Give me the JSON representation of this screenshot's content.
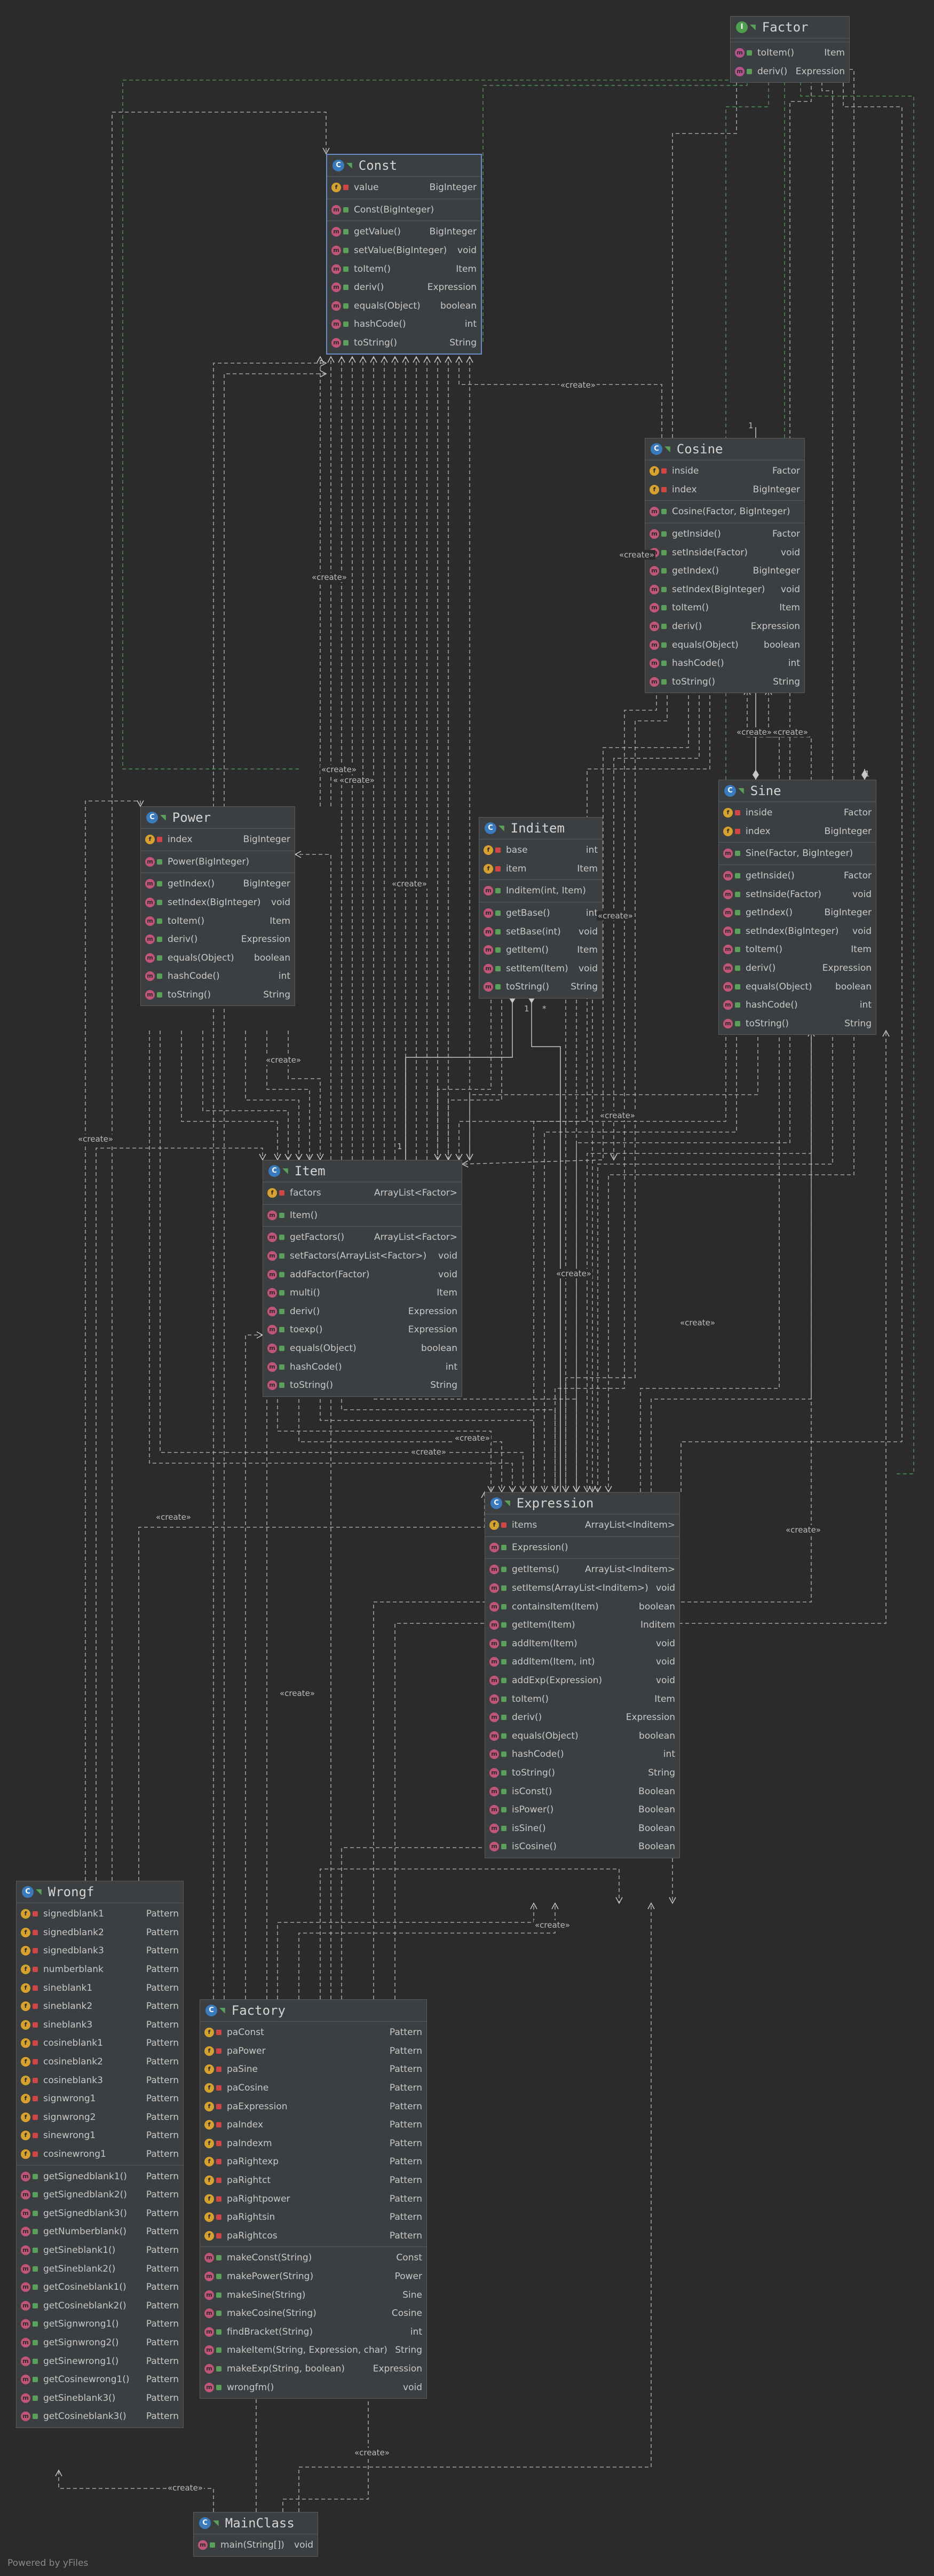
{
  "classes": {
    "factor": {
      "name": "Factor",
      "kind": "I",
      "fields": [],
      "methods": [
        {
          "name": "toItem()",
          "type": "Item"
        },
        {
          "name": "deriv()",
          "type": "Expression"
        }
      ]
    },
    "const": {
      "name": "Const",
      "kind": "C",
      "fields": [
        {
          "name": "value",
          "type": "BigInteger"
        }
      ],
      "constructors": [
        {
          "name": "Const(BigInteger)",
          "type": ""
        }
      ],
      "methods": [
        {
          "name": "getValue()",
          "type": "BigInteger"
        },
        {
          "name": "setValue(BigInteger)",
          "type": "void"
        },
        {
          "name": "toItem()",
          "type": "Item"
        },
        {
          "name": "deriv()",
          "type": "Expression"
        },
        {
          "name": "equals(Object)",
          "type": "boolean"
        },
        {
          "name": "hashCode()",
          "type": "int"
        },
        {
          "name": "toString()",
          "type": "String"
        }
      ]
    },
    "cosine": {
      "name": "Cosine",
      "kind": "C",
      "fields": [
        {
          "name": "inside",
          "type": "Factor"
        },
        {
          "name": "index",
          "type": "BigInteger"
        }
      ],
      "constructors": [
        {
          "name": "Cosine(Factor, BigInteger)",
          "type": ""
        }
      ],
      "methods": [
        {
          "name": "getInside()",
          "type": "Factor"
        },
        {
          "name": "setInside(Factor)",
          "type": "void"
        },
        {
          "name": "getIndex()",
          "type": "BigInteger"
        },
        {
          "name": "setIndex(BigInteger)",
          "type": "void"
        },
        {
          "name": "toItem()",
          "type": "Item"
        },
        {
          "name": "deriv()",
          "type": "Expression"
        },
        {
          "name": "equals(Object)",
          "type": "boolean"
        },
        {
          "name": "hashCode()",
          "type": "int"
        },
        {
          "name": "toString()",
          "type": "String"
        }
      ]
    },
    "sine": {
      "name": "Sine",
      "kind": "C",
      "fields": [
        {
          "name": "inside",
          "type": "Factor"
        },
        {
          "name": "index",
          "type": "BigInteger"
        }
      ],
      "constructors": [
        {
          "name": "Sine(Factor, BigInteger)",
          "type": ""
        }
      ],
      "methods": [
        {
          "name": "getInside()",
          "type": "Factor"
        },
        {
          "name": "setInside(Factor)",
          "type": "void"
        },
        {
          "name": "getIndex()",
          "type": "BigInteger"
        },
        {
          "name": "setIndex(BigInteger)",
          "type": "void"
        },
        {
          "name": "toItem()",
          "type": "Item"
        },
        {
          "name": "deriv()",
          "type": "Expression"
        },
        {
          "name": "equals(Object)",
          "type": "boolean"
        },
        {
          "name": "hashCode()",
          "type": "int"
        },
        {
          "name": "toString()",
          "type": "String"
        }
      ]
    },
    "power": {
      "name": "Power",
      "kind": "C",
      "fields": [
        {
          "name": "index",
          "type": "BigInteger"
        }
      ],
      "constructors": [
        {
          "name": "Power(BigInteger)",
          "type": ""
        }
      ],
      "methods": [
        {
          "name": "getIndex()",
          "type": "BigInteger"
        },
        {
          "name": "setIndex(BigInteger)",
          "type": "void"
        },
        {
          "name": "toItem()",
          "type": "Item"
        },
        {
          "name": "deriv()",
          "type": "Expression"
        },
        {
          "name": "equals(Object)",
          "type": "boolean"
        },
        {
          "name": "hashCode()",
          "type": "int"
        },
        {
          "name": "toString()",
          "type": "String"
        }
      ]
    },
    "inditem": {
      "name": "Inditem",
      "kind": "C",
      "fields": [
        {
          "name": "base",
          "type": "int"
        },
        {
          "name": "item",
          "type": "Item"
        }
      ],
      "constructors": [
        {
          "name": "Inditem(int, Item)",
          "type": ""
        }
      ],
      "methods": [
        {
          "name": "getBase()",
          "type": "int"
        },
        {
          "name": "setBase(int)",
          "type": "void"
        },
        {
          "name": "getItem()",
          "type": "Item"
        },
        {
          "name": "setItem(Item)",
          "type": "void"
        },
        {
          "name": "toString()",
          "type": "String"
        }
      ]
    },
    "item": {
      "name": "Item",
      "kind": "C",
      "fields": [
        {
          "name": "factors",
          "type": "ArrayList<Factor>"
        }
      ],
      "constructors": [
        {
          "name": "Item()",
          "type": ""
        }
      ],
      "methods": [
        {
          "name": "getFactors()",
          "type": "ArrayList<Factor>"
        },
        {
          "name": "setFactors(ArrayList<Factor>)",
          "type": "void"
        },
        {
          "name": "addFactor(Factor)",
          "type": "void"
        },
        {
          "name": "multi()",
          "type": "Item"
        },
        {
          "name": "deriv()",
          "type": "Expression"
        },
        {
          "name": "toexp()",
          "type": "Expression"
        },
        {
          "name": "equals(Object)",
          "type": "boolean"
        },
        {
          "name": "hashCode()",
          "type": "int"
        },
        {
          "name": "toString()",
          "type": "String"
        }
      ]
    },
    "expression": {
      "name": "Expression",
      "kind": "C",
      "fields": [
        {
          "name": "items",
          "type": "ArrayList<Inditem>"
        }
      ],
      "constructors": [
        {
          "name": "Expression()",
          "type": ""
        }
      ],
      "methods": [
        {
          "name": "getItems()",
          "type": "ArrayList<Inditem>"
        },
        {
          "name": "setItems(ArrayList<Inditem>)",
          "type": "void"
        },
        {
          "name": "containsItem(Item)",
          "type": "boolean"
        },
        {
          "name": "getItem(Item)",
          "type": "Inditem"
        },
        {
          "name": "addItem(Item)",
          "type": "void"
        },
        {
          "name": "addItem(Item, int)",
          "type": "void"
        },
        {
          "name": "addExp(Expression)",
          "type": "void"
        },
        {
          "name": "toItem()",
          "type": "Item"
        },
        {
          "name": "deriv()",
          "type": "Expression"
        },
        {
          "name": "equals(Object)",
          "type": "boolean"
        },
        {
          "name": "hashCode()",
          "type": "int"
        },
        {
          "name": "toString()",
          "type": "String"
        },
        {
          "name": "isConst()",
          "type": "Boolean"
        },
        {
          "name": "isPower()",
          "type": "Boolean"
        },
        {
          "name": "isSine()",
          "type": "Boolean"
        },
        {
          "name": "isCosine()",
          "type": "Boolean"
        }
      ]
    },
    "wrongf": {
      "name": "Wrongf",
      "kind": "C",
      "fields": [
        {
          "name": "signedblank1",
          "type": "Pattern"
        },
        {
          "name": "signedblank2",
          "type": "Pattern"
        },
        {
          "name": "signedblank3",
          "type": "Pattern"
        },
        {
          "name": "numberblank",
          "type": "Pattern"
        },
        {
          "name": "sineblank1",
          "type": "Pattern"
        },
        {
          "name": "sineblank2",
          "type": "Pattern"
        },
        {
          "name": "sineblank3",
          "type": "Pattern"
        },
        {
          "name": "cosineblank1",
          "type": "Pattern"
        },
        {
          "name": "cosineblank2",
          "type": "Pattern"
        },
        {
          "name": "cosineblank3",
          "type": "Pattern"
        },
        {
          "name": "signwrong1",
          "type": "Pattern"
        },
        {
          "name": "signwrong2",
          "type": "Pattern"
        },
        {
          "name": "sinewrong1",
          "type": "Pattern"
        },
        {
          "name": "cosinewrong1",
          "type": "Pattern"
        }
      ],
      "methods": [
        {
          "name": "getSignedblank1()",
          "type": "Pattern"
        },
        {
          "name": "getSignedblank2()",
          "type": "Pattern"
        },
        {
          "name": "getSignedblank3()",
          "type": "Pattern"
        },
        {
          "name": "getNumberblank()",
          "type": "Pattern"
        },
        {
          "name": "getSineblank1()",
          "type": "Pattern"
        },
        {
          "name": "getSineblank2()",
          "type": "Pattern"
        },
        {
          "name": "getCosineblank1()",
          "type": "Pattern"
        },
        {
          "name": "getCosineblank2()",
          "type": "Pattern"
        },
        {
          "name": "getSignwrong1()",
          "type": "Pattern"
        },
        {
          "name": "getSignwrong2()",
          "type": "Pattern"
        },
        {
          "name": "getSinewrong1()",
          "type": "Pattern"
        },
        {
          "name": "getCosinewrong1()",
          "type": "Pattern"
        },
        {
          "name": "getSineblank3()",
          "type": "Pattern"
        },
        {
          "name": "getCosineblank3()",
          "type": "Pattern"
        }
      ]
    },
    "factory": {
      "name": "Factory",
      "kind": "C",
      "fields": [
        {
          "name": "paConst",
          "type": "Pattern"
        },
        {
          "name": "paPower",
          "type": "Pattern"
        },
        {
          "name": "paSine",
          "type": "Pattern"
        },
        {
          "name": "paCosine",
          "type": "Pattern"
        },
        {
          "name": "paExpression",
          "type": "Pattern"
        },
        {
          "name": "paIndex",
          "type": "Pattern"
        },
        {
          "name": "paIndexm",
          "type": "Pattern"
        },
        {
          "name": "paRightexp",
          "type": "Pattern"
        },
        {
          "name": "paRightct",
          "type": "Pattern"
        },
        {
          "name": "paRightpower",
          "type": "Pattern"
        },
        {
          "name": "paRightsin",
          "type": "Pattern"
        },
        {
          "name": "paRightcos",
          "type": "Pattern"
        }
      ],
      "methods": [
        {
          "name": "makeConst(String)",
          "type": "Const"
        },
        {
          "name": "makePower(String)",
          "type": "Power"
        },
        {
          "name": "makeSine(String)",
          "type": "Sine"
        },
        {
          "name": "makeCosine(String)",
          "type": "Cosine"
        },
        {
          "name": "findBracket(String)",
          "type": "int"
        },
        {
          "name": "makeItem(String, Expression, char)",
          "type": "String"
        },
        {
          "name": "makeExp(String, boolean)",
          "type": "Expression"
        },
        {
          "name": "wrongfm()",
          "type": "void"
        }
      ]
    },
    "mainclass": {
      "name": "MainClass",
      "kind": "C",
      "fields": [],
      "methods": [
        {
          "name": "main(String[])",
          "type": "void"
        }
      ]
    }
  },
  "edge_labels": {
    "create": "«create»",
    "mult_one": "1",
    "mult_many": "*"
  },
  "footer": "Powered by yFiles"
}
